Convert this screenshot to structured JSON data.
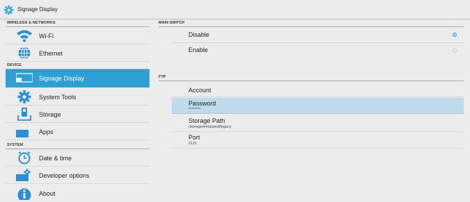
{
  "window": {
    "title": "Signage Display",
    "title_icon": "gear-icon"
  },
  "sidebar": {
    "sections": [
      {
        "header": "WIRELESS & NETWORKS",
        "items": [
          {
            "label": "Wi-Fi",
            "icon": "wifi-icon"
          },
          {
            "label": "Ethernet",
            "icon": "globe-icon"
          }
        ]
      },
      {
        "header": "DEVICE",
        "items": [
          {
            "label": "Signage Display",
            "icon": "display-icon",
            "selected": true
          },
          {
            "label": "System Tools",
            "icon": "gear-icon"
          },
          {
            "label": "Storage",
            "icon": "storage-icon"
          },
          {
            "label": "Apps",
            "icon": "apps-icon"
          }
        ]
      },
      {
        "header": "SYSTEM",
        "items": [
          {
            "label": "Date & time",
            "icon": "clock-icon"
          },
          {
            "label": "Developer options",
            "icon": "developer-icon"
          },
          {
            "label": "About",
            "icon": "info-icon"
          }
        ]
      }
    ]
  },
  "main": {
    "main_switch": {
      "header": "MAIN SWITCH",
      "options": [
        {
          "label": "Disable",
          "selected": true
        },
        {
          "label": "Enable",
          "selected": false
        }
      ]
    },
    "ftp": {
      "header": "FTP",
      "rows": [
        {
          "label": "Account",
          "sub": ""
        },
        {
          "label": "Password",
          "sub": "********",
          "highlighted": true
        },
        {
          "label": "Storage Path",
          "sub": "/storage/emulated/legacy"
        },
        {
          "label": "Port",
          "sub": "2121"
        }
      ]
    }
  },
  "colors": {
    "accent": "#2ea0d3",
    "highlight_row": "#bddbea",
    "radio_on": "#2a8fd6",
    "background": "#ececec"
  }
}
